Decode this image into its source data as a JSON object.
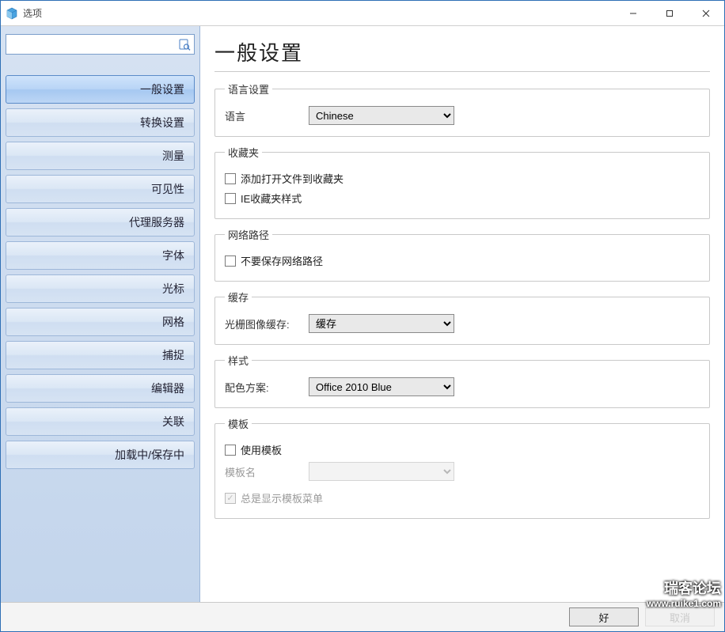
{
  "window": {
    "title": "选项"
  },
  "sidebar": {
    "search_placeholder": "",
    "items": [
      {
        "label": "一般设置",
        "active": true
      },
      {
        "label": "转换设置",
        "active": false
      },
      {
        "label": "测量",
        "active": false
      },
      {
        "label": "可见性",
        "active": false
      },
      {
        "label": "代理服务器",
        "active": false
      },
      {
        "label": "字体",
        "active": false
      },
      {
        "label": "光标",
        "active": false
      },
      {
        "label": "网格",
        "active": false
      },
      {
        "label": "捕捉",
        "active": false
      },
      {
        "label": "编辑器",
        "active": false
      },
      {
        "label": "关联",
        "active": false
      },
      {
        "label": "加载中/保存中",
        "active": false
      }
    ]
  },
  "main": {
    "title": "一般设置",
    "language_group": {
      "legend": "语言设置",
      "label": "语言",
      "value": "Chinese"
    },
    "favorites_group": {
      "legend": "收藏夹",
      "cb_add_open_to_fav": "添加打开文件到收藏夹",
      "cb_ie_fav_style": "IE收藏夹样式"
    },
    "netpath_group": {
      "legend": "网络路径",
      "cb_no_save": "不要保存网络路径"
    },
    "cache_group": {
      "legend": "缓存",
      "label": "光栅图像缓存:",
      "value": "缓存"
    },
    "style_group": {
      "legend": "样式",
      "label": "配色方案:",
      "value": "Office 2010 Blue"
    },
    "template_group": {
      "legend": "模板",
      "cb_use_template": "使用模板",
      "label_template_name": "模板名",
      "template_value": "",
      "cb_always_show_menu": "总是显示模板菜单"
    }
  },
  "footer": {
    "ok": "好",
    "cancel": "取消"
  },
  "watermark": {
    "line1": "瑞客论坛",
    "line2": "www.ruike1.com"
  }
}
